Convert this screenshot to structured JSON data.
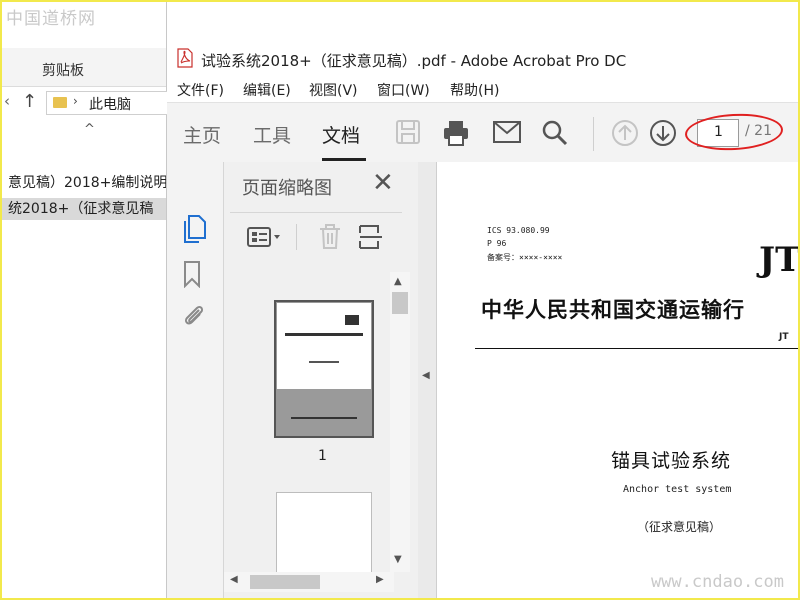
{
  "watermark": {
    "top": "中国道桥网",
    "bottom": "www.cndao.com"
  },
  "explorer": {
    "ribbon_label": "剪贴板",
    "nav": {
      "back_icon": "chevron-left-icon",
      "up_icon": "arrow-up-icon",
      "address": "此电脑"
    },
    "files": [
      "意见稿）2018+编制说明",
      "统2018+（征求意见稿"
    ]
  },
  "acrobat": {
    "title": "试验系统2018+（征求意见稿）.pdf - Adobe Acrobat Pro DC",
    "menus": [
      "文件(F)",
      "编辑(E)",
      "视图(V)",
      "窗口(W)",
      "帮助(H)"
    ],
    "tabs": [
      "主页",
      "工具",
      "文档"
    ],
    "active_tab": "文档",
    "page": {
      "current": "1",
      "total": "/ 21"
    },
    "annotation_color": "#e02020",
    "thumbnails_panel": {
      "title": "页面缩略图",
      "thumbnail_label": "1"
    },
    "document": {
      "ics": "ICS 93.080.99",
      "p": "P 96",
      "record": "备案号：××××-××××",
      "logo": "JT",
      "title": "中华人民共和国交通运输行",
      "jt_mark": "JT",
      "main_title": "锚具试验系统",
      "english_title": "Anchor test system",
      "draft": "（征求意见稿）"
    }
  }
}
